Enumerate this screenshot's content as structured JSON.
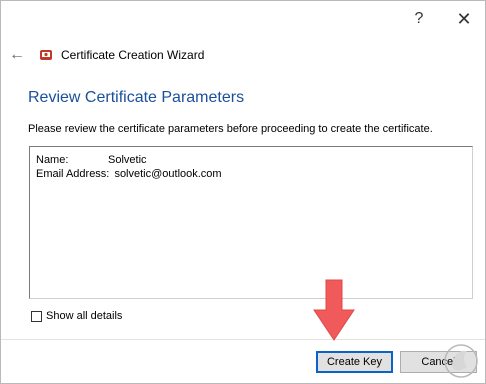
{
  "window": {
    "help_label": "?",
    "close_label": "✕"
  },
  "header": {
    "back_icon": "back-arrow-icon",
    "app_icon": "certificate-icon",
    "title": "Certificate Creation Wizard"
  },
  "page": {
    "title": "Review Certificate Parameters",
    "instructions": "Please review the certificate parameters before proceeding to create the certificate."
  },
  "params": [
    {
      "label": "Name:",
      "value": "Solvetic"
    },
    {
      "label": "Email Address:",
      "value": "solvetic@outlook.com"
    }
  ],
  "options": {
    "show_details_label": "Show all details",
    "show_details_checked": false
  },
  "buttons": {
    "create_key": "Create Key",
    "cancel": "Cancel"
  },
  "overlay": {
    "arrow_color": "#f05a5a",
    "watermark_text": "solvetic.com"
  },
  "colors": {
    "title_blue": "#1b4f9c",
    "default_button_border": "#0a64c8"
  }
}
